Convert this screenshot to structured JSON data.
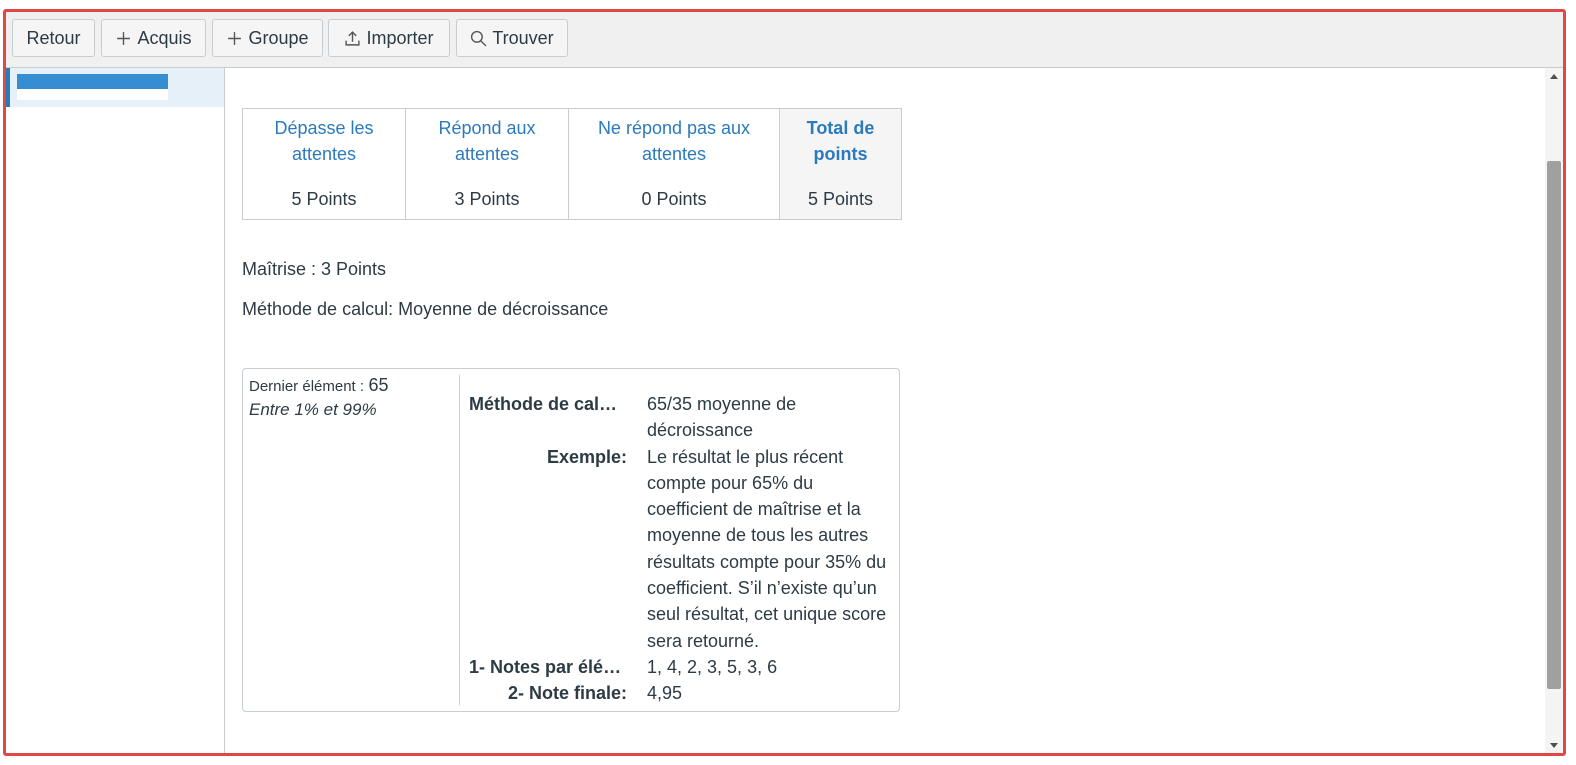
{
  "toolbar": {
    "back": "Retour",
    "add_outcome": "Acquis",
    "add_group": "Groupe",
    "import": "Importer",
    "find": "Trouver"
  },
  "rubric": {
    "levels": [
      {
        "name": "Dépasse les attentes",
        "points": "5 Points"
      },
      {
        "name": "Répond aux attentes",
        "points": "3 Points"
      },
      {
        "name": "Ne répond pas aux attentes",
        "points": "0 Points"
      }
    ],
    "total": {
      "name": "Total de points",
      "points": "5 Points"
    }
  },
  "mastery": "Maîtrise : 3 Points",
  "calc_method": "Méthode de calcul: Moyenne de décroissance",
  "calc_box": {
    "last_item_label": "Dernier élément :",
    "last_item_value": "65",
    "range": "Entre 1% et 99%",
    "rows": [
      {
        "key": "Méthode de calcul:",
        "value": "65/35 moyenne de décroissance"
      },
      {
        "key": "Exemple:",
        "value": "Le résultat le plus récent compte pour 65% du coefficient de maîtrise et la moyenne de tous les autres résultats compte pour 35% du coefficient. S’il n’existe qu’un seul résultat, cet unique score sera retourné."
      },
      {
        "key": "1- Notes par élém…",
        "value": "1, 4, 2, 3, 5, 3, 6"
      },
      {
        "key": "2- Note finale:",
        "value": "4,95"
      }
    ]
  },
  "colors": {
    "accent": "#2b7abc",
    "selection_bar": "#358ed1",
    "frame_border": "#e04848"
  }
}
